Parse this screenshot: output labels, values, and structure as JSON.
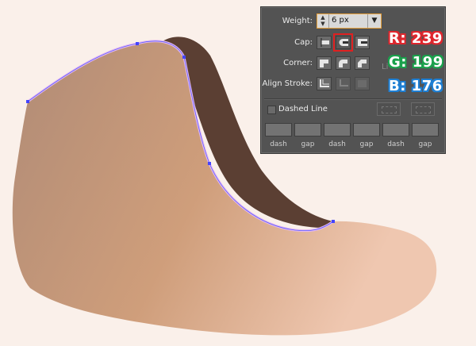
{
  "panel": {
    "weight_label": "Weight:",
    "weight_value": "6 px",
    "cap_label": "Cap:",
    "corner_label": "Corner:",
    "align_label": "Align Stroke:",
    "dashed_label": "Dashed Line",
    "obscured_label": "Li",
    "dash_labels": [
      "dash",
      "gap",
      "dash",
      "gap",
      "dash",
      "gap"
    ]
  },
  "color_readout": {
    "r": "R: 239",
    "g": "G: 199",
    "b": "B: 176"
  },
  "colors": {
    "shape_fill_start": "#b08b76",
    "shape_fill_end": "#efc7b0",
    "shadow_fill": "#5b3f33",
    "path_stroke": "#e5b9f0",
    "anchor_points": "#4444ff",
    "panel_bg": "#535353",
    "highlight": "#e02020"
  }
}
